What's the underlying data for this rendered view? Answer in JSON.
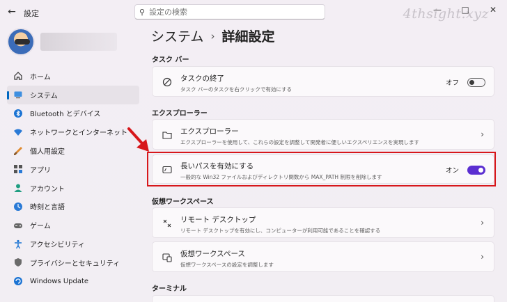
{
  "window": {
    "title": "設定",
    "search_placeholder": "設定の検索",
    "watermark": "4thsight.xyz"
  },
  "sidebar": {
    "items": [
      {
        "label": "ホーム",
        "icon": "home-icon"
      },
      {
        "label": "システム",
        "icon": "system-icon",
        "active": true
      },
      {
        "label": "Bluetooth とデバイス",
        "icon": "bluetooth-icon"
      },
      {
        "label": "ネットワークとインターネット",
        "icon": "wifi-icon"
      },
      {
        "label": "個人用設定",
        "icon": "brush-icon"
      },
      {
        "label": "アプリ",
        "icon": "apps-icon"
      },
      {
        "label": "アカウント",
        "icon": "account-icon"
      },
      {
        "label": "時刻と言語",
        "icon": "clock-globe-icon"
      },
      {
        "label": "ゲーム",
        "icon": "gamepad-icon"
      },
      {
        "label": "アクセシビリティ",
        "icon": "accessibility-icon"
      },
      {
        "label": "プライバシーとセキュリティ",
        "icon": "shield-icon"
      },
      {
        "label": "Windows Update",
        "icon": "update-icon"
      }
    ]
  },
  "breadcrumb": {
    "parent": "システム",
    "separator": "›",
    "current": "詳細設定"
  },
  "sections": {
    "taskbar": {
      "title": "タスク バー",
      "end_task": {
        "title": "タスクの終了",
        "desc": "タスク バーのタスクを右クリックで有効にする",
        "state_label": "オフ"
      }
    },
    "explorer": {
      "title": "エクスプローラー",
      "explorer_item": {
        "title": "エクスプローラー",
        "desc": "エクスプローラーを使用して、これらの設定を調整して開発者に便しいエクスペリエンスを実現します"
      },
      "long_paths": {
        "title": "長いパスを有効にする",
        "desc": "一般的な Win32 ファイルおよびディレクトリ関数から MAX_PATH 制限を削除します",
        "state_label": "オン"
      }
    },
    "virtual_workspace": {
      "title": "仮想ワークスペース",
      "remote_desktop": {
        "title": "リモート デスクトップ",
        "desc": "リモート デスクトップを有効にし、コンピューターが利用可能であることを確認する"
      },
      "workspace": {
        "title": "仮想ワークスペース",
        "desc": "仮想ワークスペースの設定を調整します"
      }
    },
    "terminal": {
      "title": "ターミナル"
    }
  },
  "colors": {
    "accent": "#5a2ed1",
    "highlight": "#d7171b",
    "nav_indicator": "#0067c0"
  }
}
